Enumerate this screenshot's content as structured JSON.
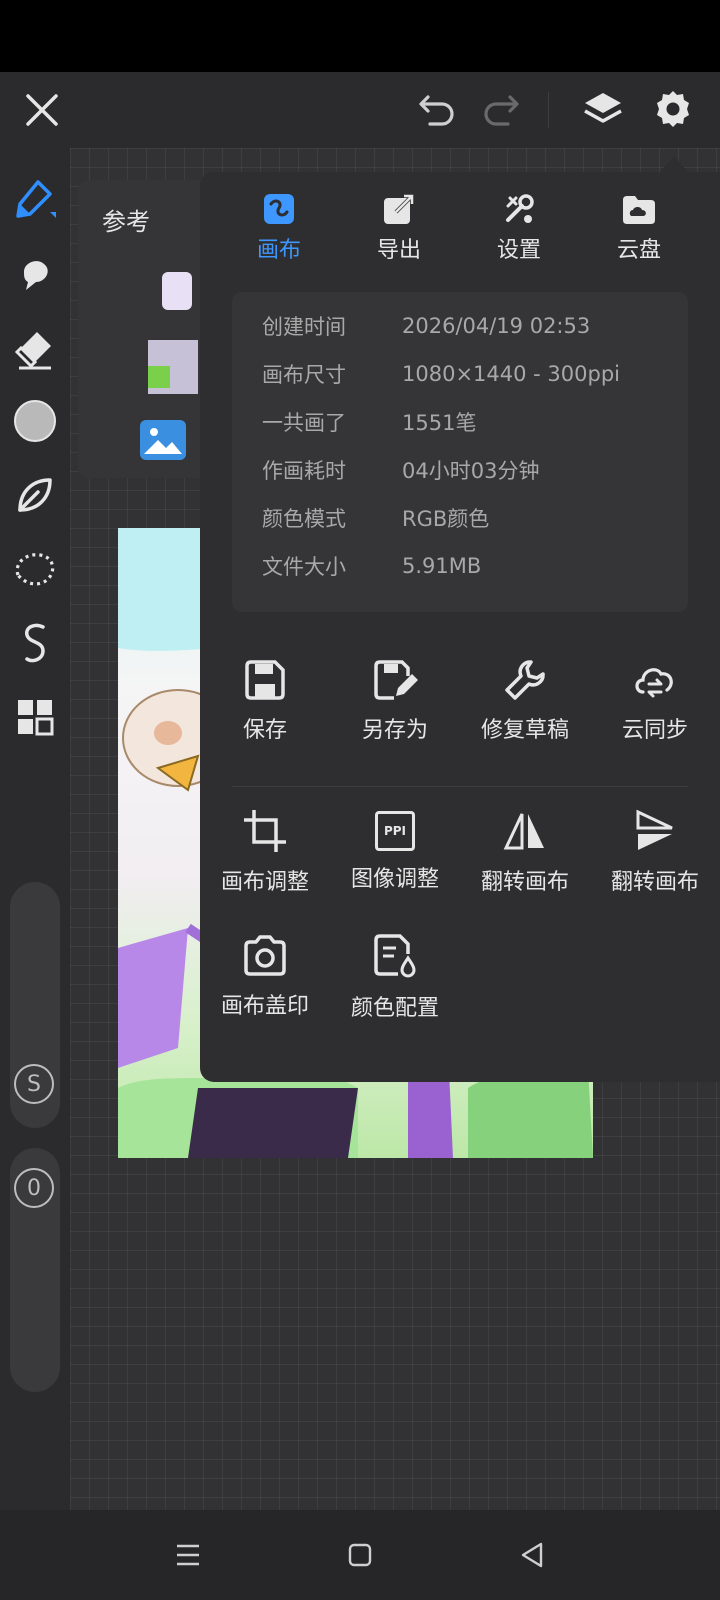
{
  "app": {
    "reference_label": "参考",
    "accent": "#3d97ff"
  },
  "top_bar": {
    "icons": [
      "close-icon",
      "undo-icon",
      "redo-icon",
      "layers-icon",
      "settings-icon"
    ]
  },
  "left_toolbar": {
    "tools": [
      "brush-icon",
      "smudge-icon",
      "eraser-icon",
      "color-circle-icon",
      "leaf-brush-icon",
      "lasso-icon",
      "stroke-icon",
      "grid-icon"
    ],
    "size_badge": "S",
    "opacity_badge": "0"
  },
  "menu": {
    "tabs": [
      {
        "label": "画布",
        "icon": "canvas-icon",
        "active": true
      },
      {
        "label": "导出",
        "icon": "export-icon",
        "active": false
      },
      {
        "label": "设置",
        "icon": "tools-icon",
        "active": false
      },
      {
        "label": "云盘",
        "icon": "cloud-disk-icon",
        "active": false
      }
    ],
    "info": [
      {
        "label": "创建时间",
        "value": "2026/04/19 02:53"
      },
      {
        "label": "画布尺寸",
        "value": "1080×1440 - 300ppi"
      },
      {
        "label": "一共画了",
        "value": "1551笔"
      },
      {
        "label": "作画耗时",
        "value": "04小时03分钟"
      },
      {
        "label": "颜色模式",
        "value": "RGB颜色"
      },
      {
        "label": "文件大小",
        "value": "5.91MB"
      }
    ],
    "actions_row1": [
      {
        "label": "保存",
        "icon": "save-icon"
      },
      {
        "label": "另存为",
        "icon": "save-as-icon"
      },
      {
        "label": "修复草稿",
        "icon": "wrench-icon"
      },
      {
        "label": "云同步",
        "icon": "cloud-sync-icon"
      }
    ],
    "actions_row2": [
      {
        "label": "画布调整",
        "icon": "crop-icon"
      },
      {
        "label": "图像调整",
        "icon": "ppi-icon"
      },
      {
        "label": "翻转画布",
        "icon": "flip-horizontal-icon"
      },
      {
        "label": "翻转画布",
        "icon": "flip-vertical-icon"
      }
    ],
    "actions_row3": [
      {
        "label": "画布盖印",
        "icon": "camera-icon"
      },
      {
        "label": "颜色配置",
        "icon": "color-profile-icon"
      }
    ],
    "ppi_text": "PPI"
  }
}
